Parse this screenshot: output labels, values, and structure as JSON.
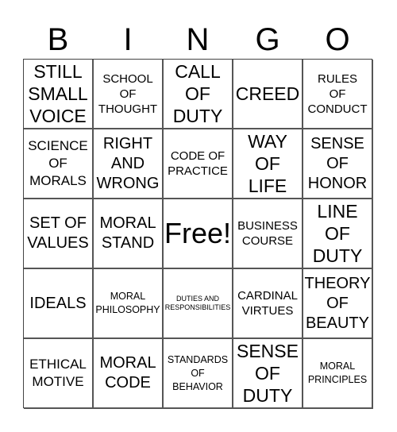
{
  "header": {
    "letters": [
      "B",
      "I",
      "N",
      "G",
      "O"
    ]
  },
  "cells": [
    {
      "text": "STILL\nSMALL\nVOICE",
      "size": "l"
    },
    {
      "text": "SCHOOL\nOF\nTHOUGHT",
      "size": "s"
    },
    {
      "text": "CALL\nOF\nDUTY",
      "size": "l"
    },
    {
      "text": "CREED",
      "size": "l"
    },
    {
      "text": "RULES\nOF\nCONDUCT",
      "size": "s"
    },
    {
      "text": "SCIENCE\nOF\nMORALS",
      "size": "ms"
    },
    {
      "text": "RIGHT\nAND\nWRONG",
      "size": "m"
    },
    {
      "text": "CODE OF\nPRACTICE",
      "size": "s"
    },
    {
      "text": "WAY\nOF\nLIFE",
      "size": "l"
    },
    {
      "text": "SENSE\nOF\nHONOR",
      "size": "m"
    },
    {
      "text": "SET OF\nVALUES",
      "size": "m"
    },
    {
      "text": "MORAL\nSTAND",
      "size": "m"
    },
    {
      "text": "Free!",
      "size": "xl"
    },
    {
      "text": "BUSINESS\nCOURSE",
      "size": "s"
    },
    {
      "text": "LINE\nOF\nDUTY",
      "size": "l"
    },
    {
      "text": "IDEALS",
      "size": "m"
    },
    {
      "text": "MORAL\nPHILOSOPHY",
      "size": "xs"
    },
    {
      "text": "DUTIES AND\nRESPONSIBILITIES",
      "size": "xxs"
    },
    {
      "text": "CARDINAL\nVIRTUES",
      "size": "s"
    },
    {
      "text": "THEORY\nOF\nBEAUTY",
      "size": "m"
    },
    {
      "text": "ETHICAL\nMOTIVE",
      "size": "ms"
    },
    {
      "text": "MORAL\nCODE",
      "size": "m"
    },
    {
      "text": "STANDARDS\nOF\nBEHAVIOR",
      "size": "xs"
    },
    {
      "text": "SENSE\nOF\nDUTY",
      "size": "l"
    },
    {
      "text": "MORAL\nPRINCIPLES",
      "size": "xs"
    }
  ]
}
